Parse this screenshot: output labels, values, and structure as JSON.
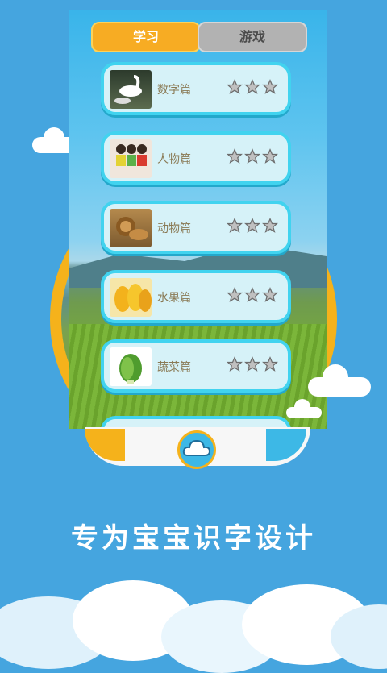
{
  "tabs": {
    "study": "学习",
    "game": "游戏"
  },
  "categories": [
    {
      "label": "数字篇",
      "stars": 3
    },
    {
      "label": "人物篇",
      "stars": 3
    },
    {
      "label": "动物篇",
      "stars": 3
    },
    {
      "label": "水果篇",
      "stars": 3
    },
    {
      "label": "蔬菜篇",
      "stars": 3
    }
  ],
  "tagline": "专为宝宝识字设计",
  "colors": {
    "background": "#45a5df",
    "accent": "#f5b21b",
    "tab_active": "#f7ac23",
    "card_border": "#41d3ef"
  }
}
